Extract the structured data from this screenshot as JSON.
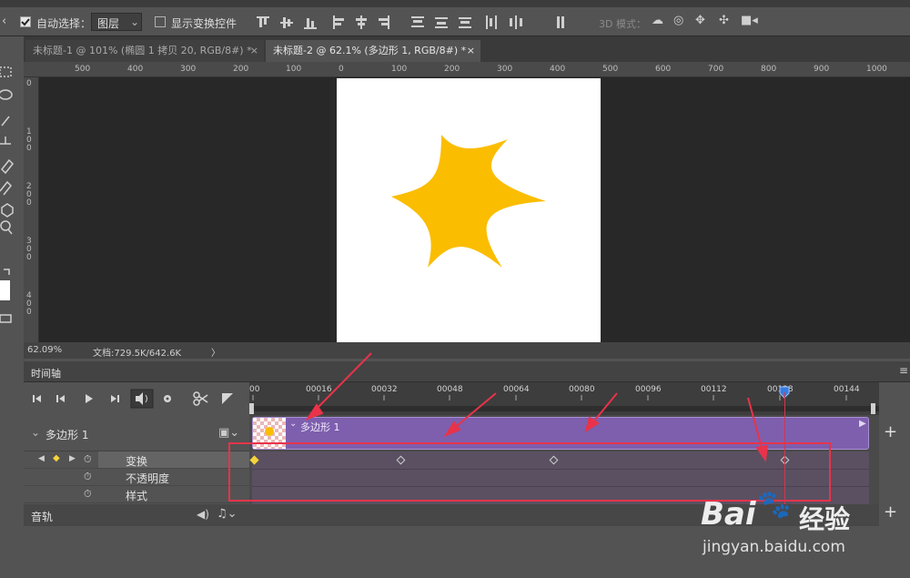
{
  "options_bar": {
    "auto_select_label": "自动选择：",
    "auto_select_value": "图层",
    "show_transform_label": "显示变换控件",
    "mode_3d_label": "3D 模式："
  },
  "doc_tabs": [
    {
      "label": "未标题-1 @ 101% (椭圆 1 拷贝 20, RGB/8#) *",
      "close": "×"
    },
    {
      "label": "未标题-2 @ 62.1% (多边形 1, RGB/8#) *",
      "close": "×"
    }
  ],
  "ruler_top": [
    "500",
    "400",
    "300",
    "200",
    "100",
    "0",
    "100",
    "200",
    "300",
    "400",
    "500",
    "600",
    "700",
    "800",
    "900",
    "1000"
  ],
  "ruler_left": [
    "0",
    "1 0 0",
    "2 0 0",
    "3 0 0",
    "4 0 0"
  ],
  "status": {
    "zoom": "62.09%",
    "doc_info": "文档:729.5K/642.6K",
    "arrow": "〉"
  },
  "panel": {
    "title": "时间轴",
    "menu_icon": "≡"
  },
  "timeline": {
    "ticks": [
      "00",
      "00016",
      "00032",
      "00048",
      "00064",
      "00080",
      "00096",
      "00112",
      "00128",
      "00144"
    ],
    "layer_name": "多边形 1",
    "clip_label": "多边形 1",
    "properties": [
      "变换",
      "不透明度",
      "样式"
    ],
    "audio_label": "音轨",
    "add": "+"
  },
  "watermark": {
    "brand": "Bai",
    "brand_cn": "经验",
    "url": "jingyan.baidu.com"
  },
  "colors": {
    "star": "#fbbd00",
    "clip": "#7d5fae",
    "annotation": "#e8334a",
    "playhead": "#3a7be0"
  }
}
